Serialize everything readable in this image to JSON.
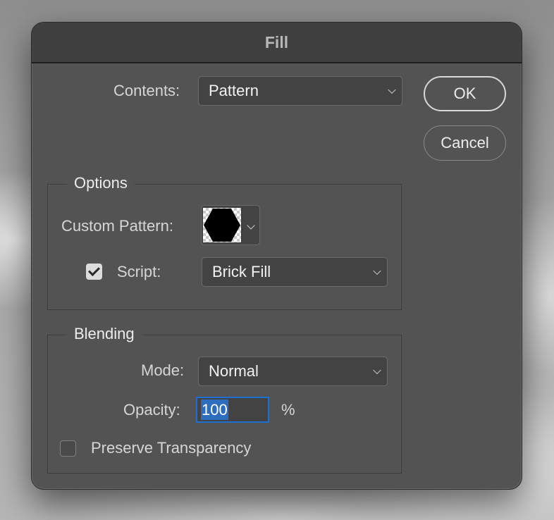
{
  "dialog": {
    "title": "Fill",
    "contents": {
      "label": "Contents:",
      "value": "Pattern"
    },
    "buttons": {
      "ok": "OK",
      "cancel": "Cancel"
    },
    "options": {
      "title": "Options",
      "custom_pattern_label": "Custom Pattern:",
      "custom_pattern_icon": "hexagon-pattern",
      "script_checked": true,
      "script_label": "Script:",
      "script_value": "Brick Fill"
    },
    "blending": {
      "title": "Blending",
      "mode_label": "Mode:",
      "mode_value": "Normal",
      "opacity_label": "Opacity:",
      "opacity_value": "100",
      "opacity_unit": "%",
      "preserve_transparency_label": "Preserve Transparency",
      "preserve_transparency_checked": false
    }
  },
  "colors": {
    "dialog_bg": "#535353",
    "titlebar_bg": "#404040",
    "focus_blue": "#1d6fd1",
    "selection_blue": "#2d6dbd"
  }
}
